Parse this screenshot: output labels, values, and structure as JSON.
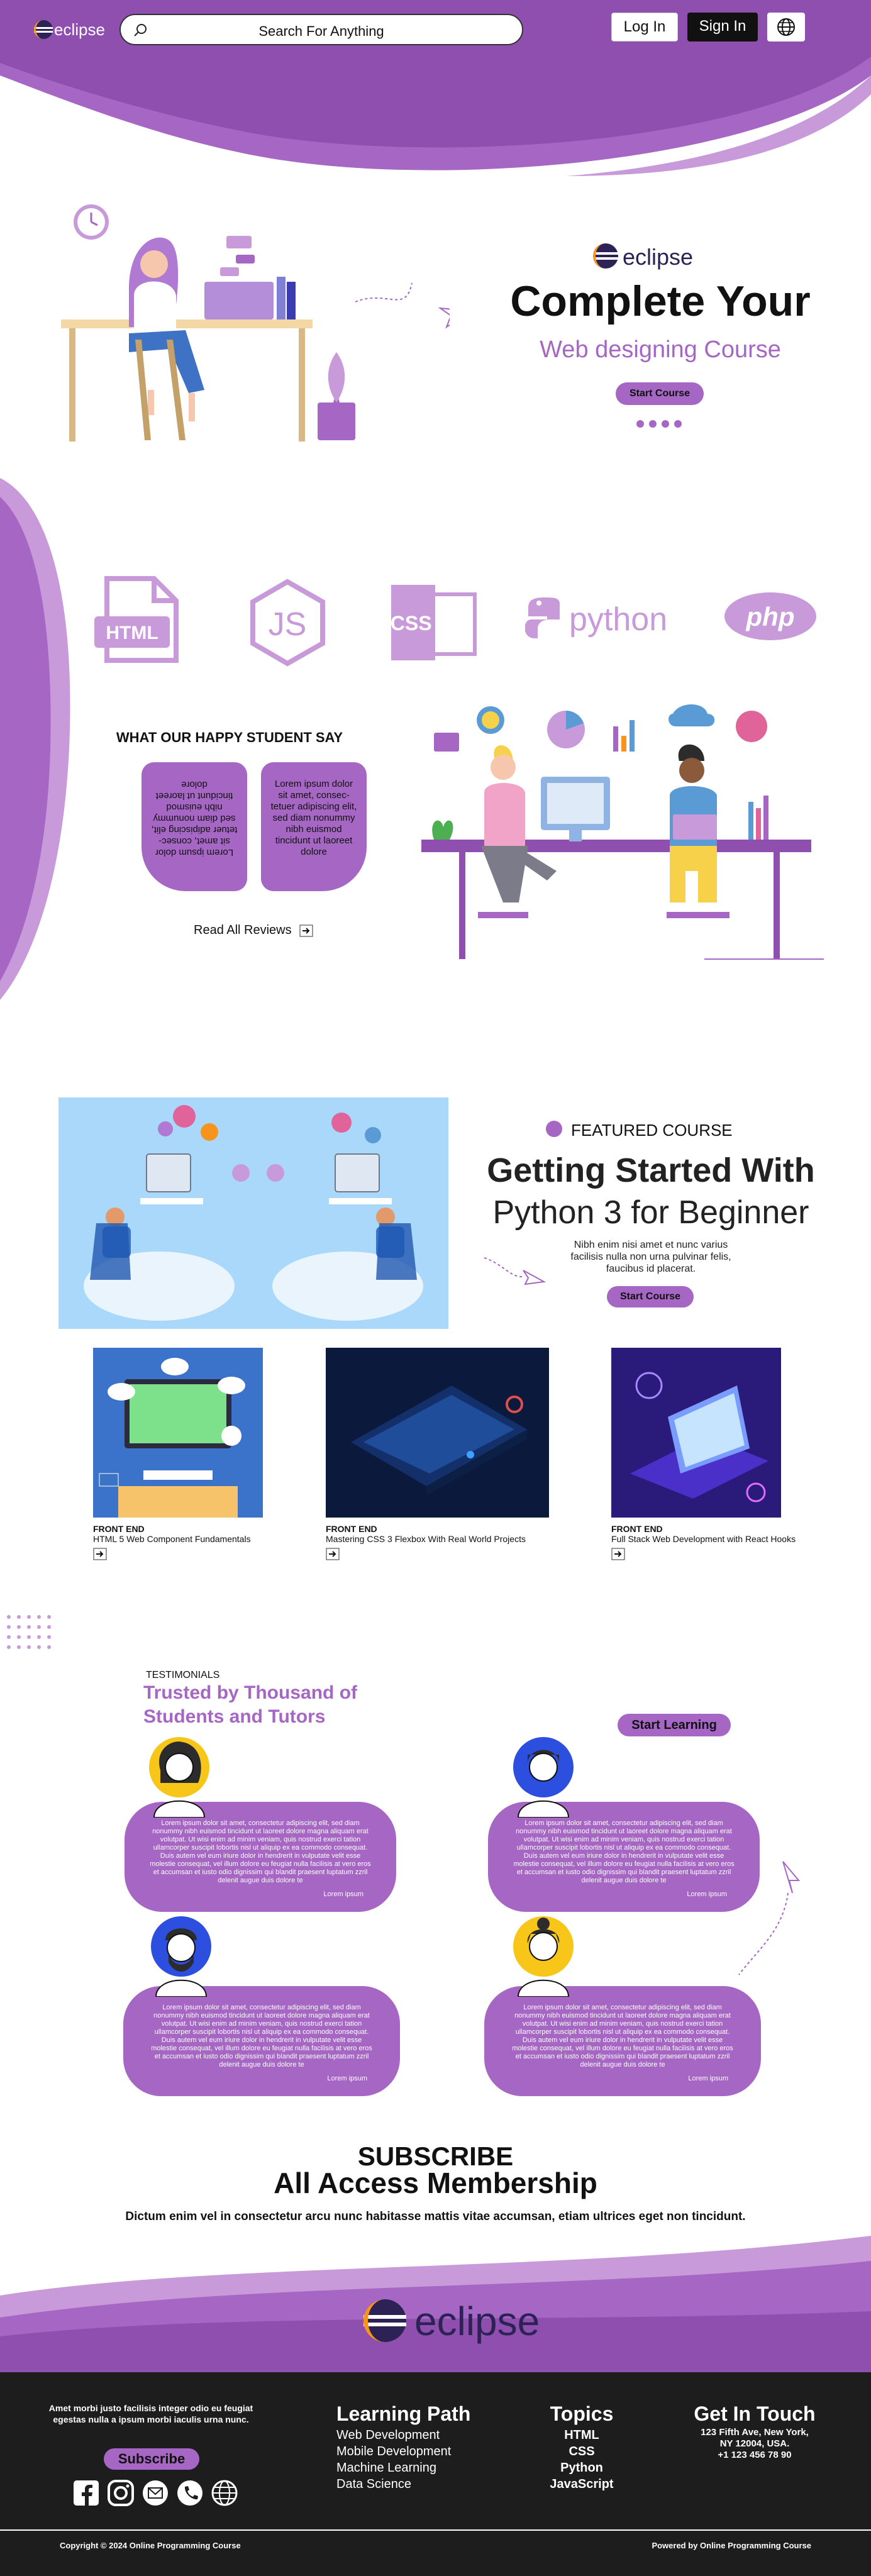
{
  "colors": {
    "accent": "#a566c4",
    "accent_light": "#c99ad9",
    "dark": "#1d1d1d"
  },
  "header": {
    "logo_text": "eclipse",
    "search_placeholder": "Search  For  Anything",
    "login_label": "Log In",
    "signin_label": "Sign In",
    "globe_icon": "globe-icon"
  },
  "hero": {
    "brand": "eclipse",
    "title": "Complete Your",
    "subtitle": "Web designing Course",
    "cta": "Start Course"
  },
  "tech_logos": [
    "HTML",
    "JS",
    "CSS { }",
    "python",
    "php"
  ],
  "reviews": {
    "heading": "WHAT OUR HAPPY STUDENT SAY",
    "card1": "Lorem ipsum dolor sit amet, consec-tetuer adipiscing elit, sed diam nonummy nibh euismod tincidunt ut laoreet dolore",
    "card2": "Lorem ipsum dolor sit amet, consec-tetuer adipiscing elit, sed diam nonummy nibh euismod tincidunt ut laoreet dolore",
    "read_all": "Read All Reviews"
  },
  "featured": {
    "label": "FEATURED COURSE",
    "title1": "Getting Started With",
    "title2": "Python 3 for Beginner",
    "desc": "Nibh enim nisi amet et nunc varius facilisis nulla non urna pulvinar felis, faucibus id placerat.",
    "cta": "Start Course"
  },
  "courses": [
    {
      "category": "FRONT END",
      "title": "HTML 5 Web Component Fundamentals"
    },
    {
      "category": "FRONT END",
      "title": "Mastering CSS 3 Flexbox With Real World Projects"
    },
    {
      "category": "FRONT END",
      "title": "Full Stack Web Development with React Hooks"
    }
  ],
  "testimonials": {
    "label": "TESTIMONIALS",
    "heading1": "Trusted by Thousand of",
    "heading2": "Students and Tutors",
    "cta": "Start Learning",
    "body": "Lorem ipsum dolor sit amet, consectetur adipiscing elit, sed diam nonummy nibh euismod tincidunt ut laoreet dolore magna aliquam erat volutpat. Ut wisi enim ad minim veniam, quis nostrud exerci tation ullamcorper suscipit lobortis nisl ut aliquip ex ea commodo consequat. Duis autem vel eum iriure dolor in hendrerit in vulputate velit esse molestie consequat, vel illum dolore eu feugiat nulla facilisis at vero eros et accumsan et iusto odio dignissim qui blandit praesent luptatum zzril delenit augue duis dolore te",
    "author": "Lorem ipsum"
  },
  "subscribe": {
    "title1": "SUBSCRIBE",
    "title2": "All Access Membership",
    "desc": "Dictum enim vel in consectetur arcu nunc habitasse mattis vitae accumsan, etiam ultrices eget non tincidunt."
  },
  "banner": {
    "logo_text": "eclipse"
  },
  "footer": {
    "about": "Amet morbi justo facilisis integer odio eu feugiat egestas nulla a ipsum morbi iaculis urna nunc.",
    "subscribe": "Subscribe",
    "learning_title": "Learning Path",
    "learning_items": [
      "Web Development",
      "Mobile Development",
      "Machine Learning",
      "Data Science"
    ],
    "topics_title": "Topics",
    "topics_items": [
      "HTML",
      "CSS",
      "Python",
      "JavaScript"
    ],
    "contact_title": "Get In Touch",
    "contact_lines": [
      "123 Fifth Ave, New York,",
      "NY 12004, USA.",
      "+1 123 456 78 90"
    ],
    "copyright": "Copyright © 2024 Online Programming Course",
    "powered": "Powered by Online Programming Course"
  }
}
